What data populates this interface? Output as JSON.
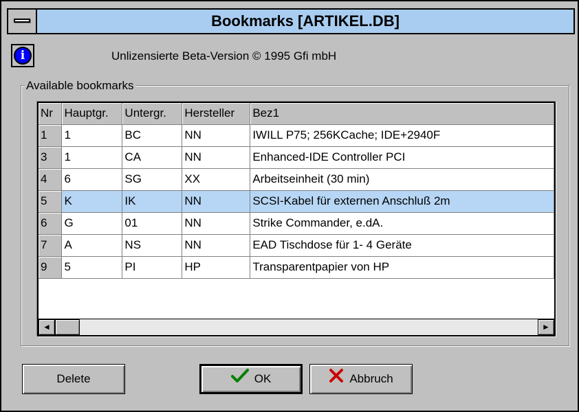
{
  "window": {
    "title": "Bookmarks [ARTIKEL.DB]"
  },
  "banner": {
    "text": "Unlizensierte Beta-Version © 1995 Gfi mbH",
    "info_icon": "i"
  },
  "group": {
    "label": "Available bookmarks"
  },
  "table": {
    "columns": [
      "Nr",
      "Hauptgr.",
      "Untergr.",
      "Hersteller",
      "Bez1"
    ],
    "rows": [
      [
        "1",
        "1",
        "BC",
        "NN",
        "IWILL P75; 256KCache; IDE+2940F"
      ],
      [
        "3",
        "1",
        "CA",
        "NN",
        "Enhanced-IDE Controller PCI"
      ],
      [
        "4",
        "6",
        "SG",
        "XX",
        "Arbeitseinheit (30 min)"
      ],
      [
        "5",
        "K",
        "IK",
        "NN",
        "SCSI-Kabel für externen Anschluß 2m"
      ],
      [
        "6",
        "G",
        "01",
        "NN",
        "Strike Commander, e.dA."
      ],
      [
        "7",
        "A",
        "NS",
        "NN",
        "EAD Tischdose für 1- 4 Geräte"
      ],
      [
        "9",
        "5",
        "PI",
        "HP",
        "Transparentpapier von HP"
      ]
    ],
    "selected_row": 3
  },
  "scrollbar": {
    "left_arrow": "◄",
    "right_arrow": "►"
  },
  "buttons": {
    "delete": "Delete",
    "ok": "OK",
    "cancel": "Abbruch"
  },
  "colors": {
    "title_bar": "#a9cdf1",
    "selection": "#b7d6f5",
    "ok_check": "#008000",
    "cancel_x": "#cc0000"
  }
}
